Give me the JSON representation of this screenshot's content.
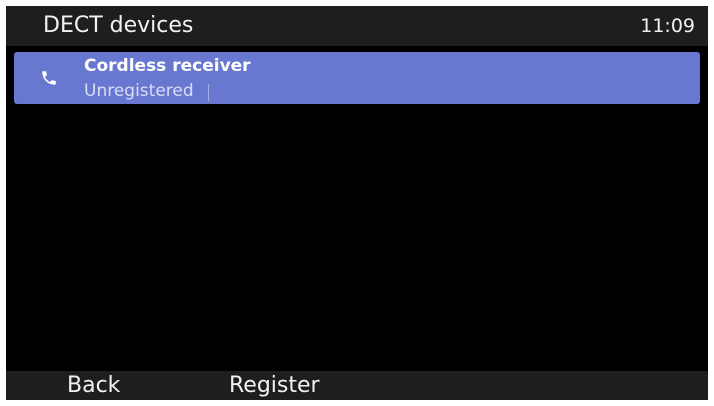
{
  "header": {
    "title": "DECT devices",
    "clock": "11:09"
  },
  "devices": [
    {
      "icon": "phone-icon",
      "name": "Cordless receiver",
      "status": "Unregistered",
      "selected": true
    }
  ],
  "softkeys": {
    "back": "Back",
    "register": "Register"
  },
  "colors": {
    "background": "#000000",
    "bar": "#1e1e1e",
    "selection": "#6878d0",
    "text": "#f2f2f2"
  }
}
